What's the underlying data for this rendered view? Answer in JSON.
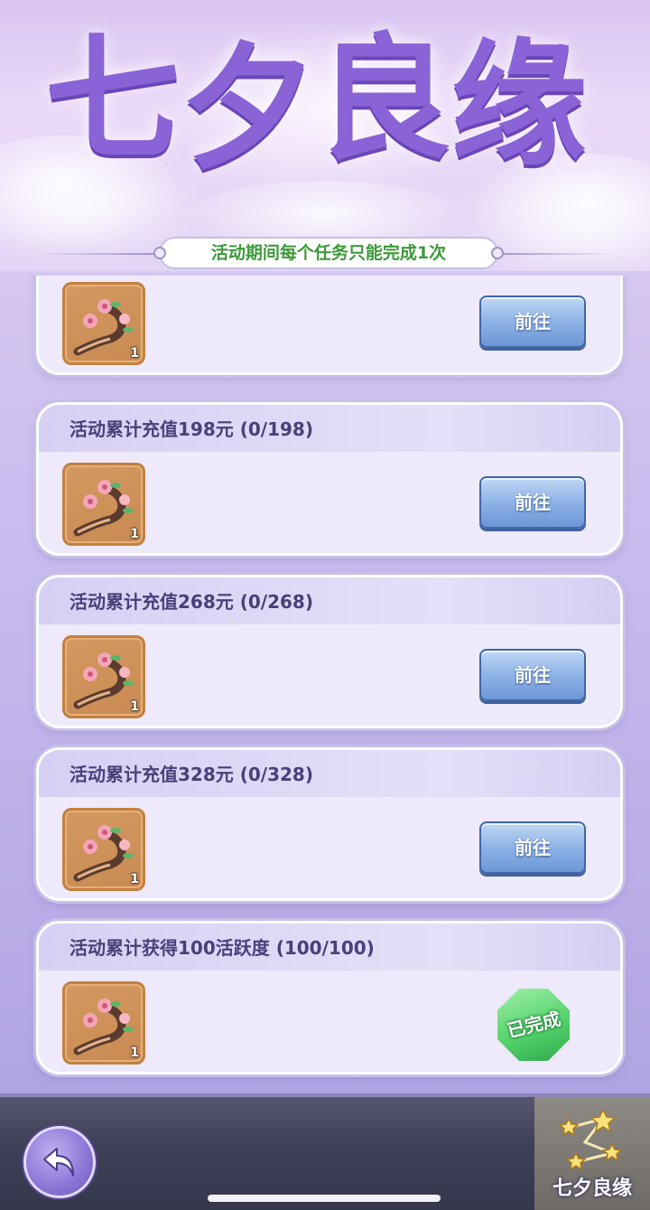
{
  "header": {
    "title_chars": [
      "七",
      "夕",
      "良",
      "缘"
    ],
    "notice": "活动期间每个任务只能完成1次"
  },
  "tasks": [
    {
      "title": "",
      "reward_qty": "1",
      "action": "前往",
      "status": "go",
      "reward_icon": "peach-blossom-branch-icon"
    },
    {
      "title": "活动累计充值198元 (0/198)",
      "reward_qty": "1",
      "action": "前往",
      "status": "go",
      "reward_icon": "peach-blossom-branch-icon"
    },
    {
      "title": "活动累计充值268元 (0/268)",
      "reward_qty": "1",
      "action": "前往",
      "status": "go",
      "reward_icon": "peach-blossom-branch-icon"
    },
    {
      "title": "活动累计充值328元 (0/328)",
      "reward_qty": "1",
      "action": "前往",
      "status": "go",
      "reward_icon": "peach-blossom-branch-icon"
    },
    {
      "title": "活动累计获得100活跃度 (100/100)",
      "reward_qty": "1",
      "action": "已完成",
      "status": "done",
      "reward_icon": "peach-blossom-branch-icon"
    }
  ],
  "bottom": {
    "back_icon": "back-arrow-icon",
    "event_tab_label": "七夕良缘",
    "event_tab_icon": "star-constellation-icon"
  },
  "colors": {
    "notice_text": "#3d9a3a",
    "done_stamp": "#4fcf68",
    "go_button": "#8eb3e6",
    "title_purple": "#8a63d6"
  }
}
